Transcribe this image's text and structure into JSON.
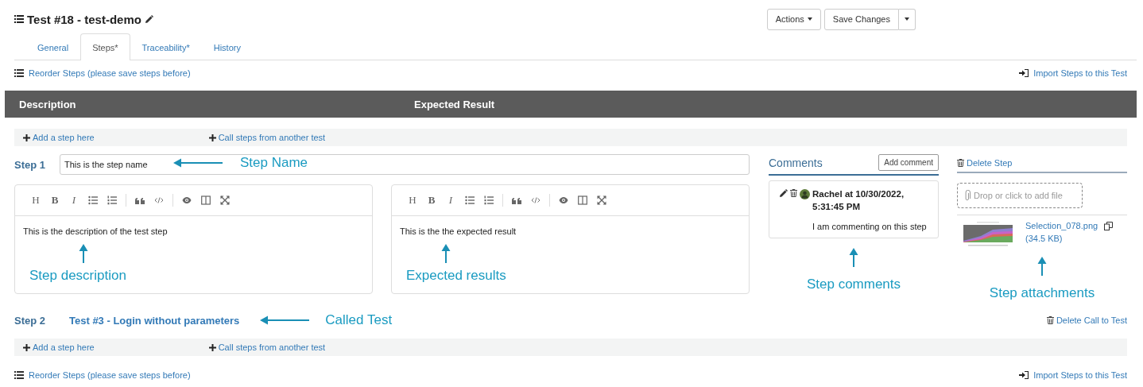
{
  "header": {
    "title": "Test #18 - test-demo",
    "buttons": [
      {
        "label": "Actions",
        "kind": "dropdown"
      },
      {
        "label": "Save Changes",
        "kind": "split"
      }
    ]
  },
  "tabs": [
    {
      "label": "General",
      "selected": false
    },
    {
      "label": "Steps*",
      "selected": true
    },
    {
      "label": "Traceability*",
      "selected": false
    },
    {
      "label": "History",
      "selected": false
    }
  ],
  "top_links": {
    "reorder": "Reorder Steps (please save steps before)",
    "import": "Import Steps to this Test"
  },
  "columns": [
    "Description",
    "Expected Result"
  ],
  "add_bar_top": {
    "add": "Add a step here",
    "call": "Call steps from another test"
  },
  "steps": [
    {
      "kind": "step",
      "number": "Step 1",
      "name": "This is the step name",
      "name_note": "Step Name",
      "editors": [
        {
          "text": "This is the description of the test step",
          "note": "Step description",
          "tools": [
            "H",
            "B",
            "I"
          ]
        },
        {
          "text": "This is the the expected result",
          "note": "Expected results",
          "tools": [
            "H",
            "B",
            "I"
          ]
        }
      ],
      "comments": {
        "title": "Comments",
        "add": "Add comment",
        "items": [
          {
            "author": "Rachel at 10/30/2022, 5:31:45 PM",
            "text": "I am commenting on this step"
          }
        ],
        "note": "Step comments"
      },
      "attachments": {
        "delete": "Delete Step",
        "dropzone": "Drop or click to add file",
        "files": [
          {
            "name": "Selection_078.png",
            "size": "(34.5 KB)"
          }
        ],
        "note": "Step attachments"
      }
    },
    {
      "kind": "call",
      "number": "Step 2",
      "test": "Test #3 - Login without parameters",
      "note": "Called Test",
      "delete": "Delete Call to Test"
    }
  ],
  "add_bar_bottom": {
    "add": "Add a step here",
    "call": "Call steps from another test"
  },
  "bottom_links": {
    "reorder": "Reorder Steps (please save steps before)",
    "import": "Import Steps to this Test"
  }
}
